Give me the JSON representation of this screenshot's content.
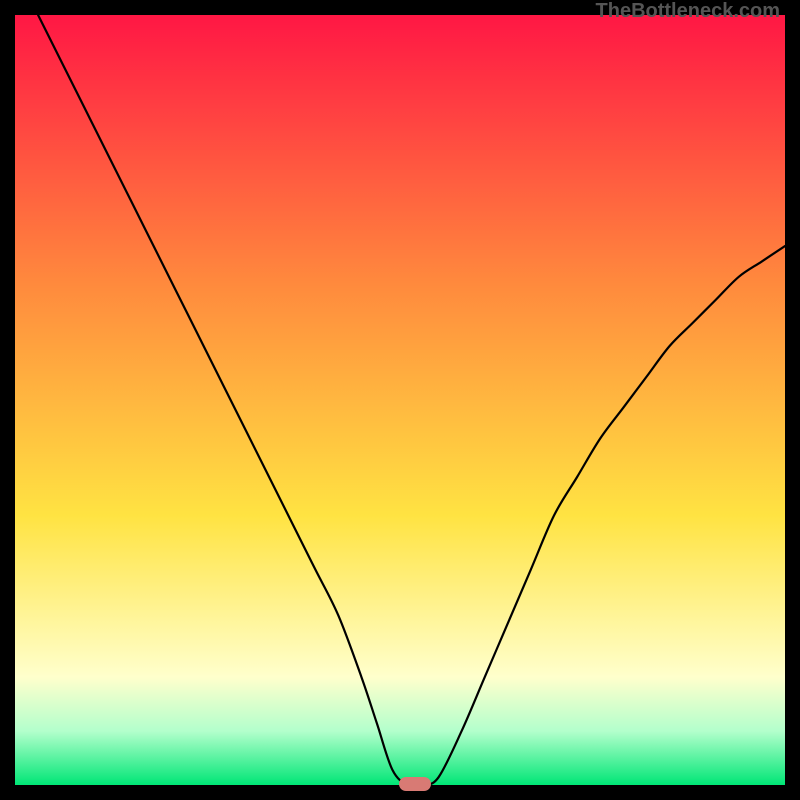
{
  "watermark": "TheBottleneck.com",
  "colors": {
    "top_red": "#ff1744",
    "mid_orange": "#ff8a3d",
    "yellow": "#ffe342",
    "pale_yellow": "#ffffcc",
    "light_green": "#b3ffcc",
    "green": "#00e676",
    "curve_stroke": "#000000",
    "marker_fill": "#d87a74",
    "background_black": "#000000"
  },
  "chart_data": {
    "type": "line",
    "title": "",
    "xlabel": "",
    "ylabel": "",
    "xlim": [
      0,
      100
    ],
    "ylim": [
      0,
      100
    ],
    "x": [
      3,
      6,
      9,
      12,
      15,
      18,
      21,
      24,
      27,
      30,
      33,
      36,
      39,
      42,
      45,
      47,
      49,
      51,
      53,
      55,
      58,
      61,
      64,
      67,
      70,
      73,
      76,
      79,
      82,
      85,
      88,
      91,
      94,
      97,
      100
    ],
    "y": [
      100,
      94,
      88,
      82,
      76,
      70,
      64,
      58,
      52,
      46,
      40,
      34,
      28,
      22,
      14,
      8,
      2,
      0,
      0,
      1,
      7,
      14,
      21,
      28,
      35,
      40,
      45,
      49,
      53,
      57,
      60,
      63,
      66,
      68,
      70
    ],
    "marker": {
      "x": 52,
      "y": 0
    },
    "gradient_stops": [
      {
        "offset": 0.0,
        "color": "#ff1744"
      },
      {
        "offset": 0.35,
        "color": "#ff8a3d"
      },
      {
        "offset": 0.65,
        "color": "#ffe342"
      },
      {
        "offset": 0.86,
        "color": "#ffffcc"
      },
      {
        "offset": 0.93,
        "color": "#b3ffcc"
      },
      {
        "offset": 1.0,
        "color": "#00e676"
      }
    ]
  }
}
